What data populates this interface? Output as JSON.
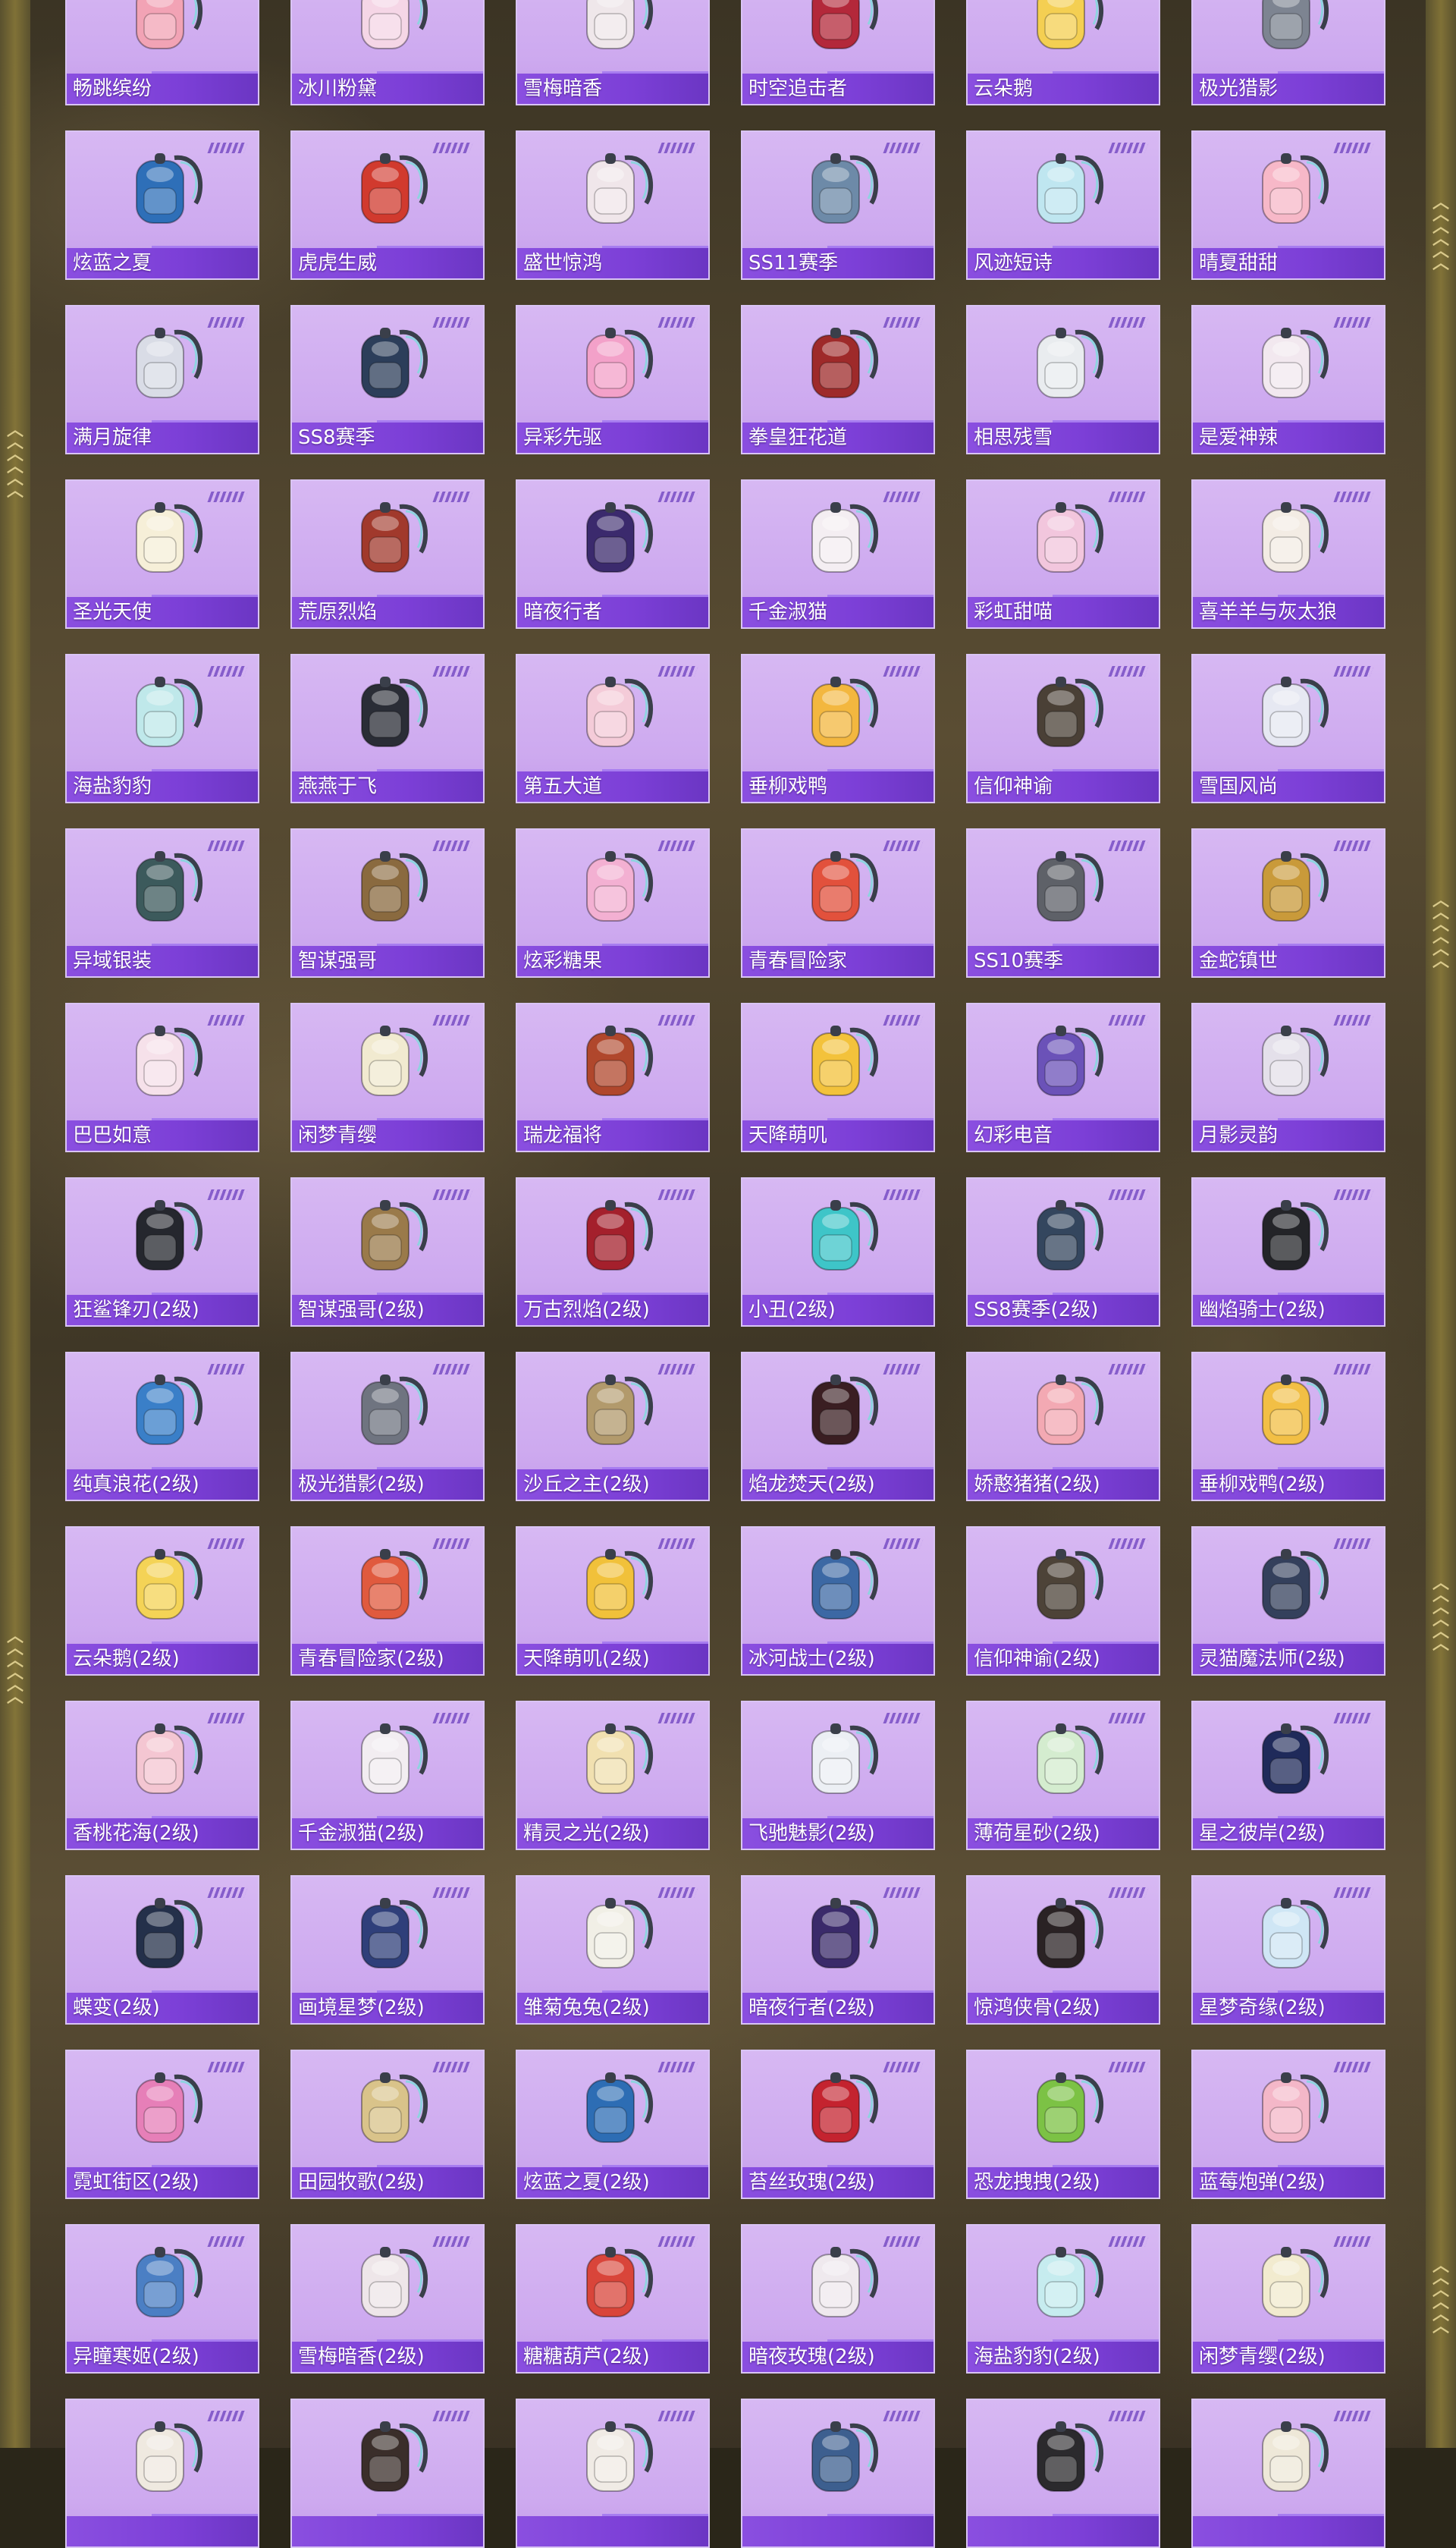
{
  "theme": {
    "card_bg": "#d7b8f3",
    "label_bg": "#7c3fd7",
    "label_text": "#ffffff",
    "accent": "#8c7c3a"
  },
  "items": [
    {
      "name": "畅跳缤纷",
      "icon": "pastel-pink-backpack",
      "color": "#f2a3b5"
    },
    {
      "name": "冰川粉黛",
      "icon": "winged-pink-backpack",
      "color": "#f5d6e6"
    },
    {
      "name": "雪梅暗香",
      "icon": "white-plum-backpack",
      "color": "#efe7ea"
    },
    {
      "name": "时空追击者",
      "icon": "red-mech-backpack",
      "color": "#b3283a"
    },
    {
      "name": "云朵鹅",
      "icon": "yellow-duck-backpack",
      "color": "#f4cf52"
    },
    {
      "name": "极光猎影",
      "icon": "silver-armor-backpack",
      "color": "#7d8491"
    },
    {
      "name": "炫蓝之夏",
      "icon": "blue-tech-backpack",
      "color": "#2e6fb8"
    },
    {
      "name": "虎虎生威",
      "icon": "red-tiger-backpack",
      "color": "#d13a2e"
    },
    {
      "name": "盛世惊鸿",
      "icon": "white-feather-backpack",
      "color": "#f0e6ea"
    },
    {
      "name": "SS11赛季",
      "icon": "blue-grey-backpack",
      "color": "#6d8aa8"
    },
    {
      "name": "风迹短诗",
      "icon": "aqua-crystal-backpack",
      "color": "#bfe6f0"
    },
    {
      "name": "晴夏甜甜",
      "icon": "pink-bunny-backpack",
      "color": "#f7b8c8"
    },
    {
      "name": "满月旋律",
      "icon": "silver-moon-backpack",
      "color": "#d9dce6"
    },
    {
      "name": "SS8赛季",
      "icon": "dark-blue-backpack",
      "color": "#2c3e5a"
    },
    {
      "name": "异彩先驱",
      "icon": "pink-xo-backpack",
      "color": "#f3a1c9"
    },
    {
      "name": "拳皇狂花道",
      "icon": "red-fighter-backpack",
      "color": "#9e2a2a"
    },
    {
      "name": "相思残雪",
      "icon": "white-snow-backpack",
      "color": "#e9ecef"
    },
    {
      "name": "是爱神辣",
      "icon": "white-bunny-backpack",
      "color": "#f2e8ef"
    },
    {
      "name": "圣光天使",
      "icon": "angel-wing-backpack",
      "color": "#f6efd8"
    },
    {
      "name": "荒原烈焰",
      "icon": "red-flame-backpack",
      "color": "#a1392c"
    },
    {
      "name": "暗夜行者",
      "icon": "neon-cat-backpack",
      "color": "#3b2a6d"
    },
    {
      "name": "千金淑猫",
      "icon": "white-cat-backpack",
      "color": "#f4eef2"
    },
    {
      "name": "彩虹甜喵",
      "icon": "pink-cat-backpack",
      "color": "#f2c6dd"
    },
    {
      "name": "喜羊羊与灰太狼",
      "icon": "sheep-backpack",
      "color": "#f3ece4"
    },
    {
      "name": "海盐豹豹",
      "icon": "teal-seal-backpack",
      "color": "#bfe8ea"
    },
    {
      "name": "燕燕于飞",
      "icon": "black-swallow-backpack",
      "color": "#2a2d36"
    },
    {
      "name": "第五大道",
      "icon": "pink-quilted-backpack",
      "color": "#f4cbd8"
    },
    {
      "name": "垂柳戏鸭",
      "icon": "yellow-duck-plush-backpack",
      "color": "#f3b73f"
    },
    {
      "name": "信仰神谕",
      "icon": "dark-gold-crest-backpack",
      "color": "#4a4036"
    },
    {
      "name": "雪国风尚",
      "icon": "penguin-backpack",
      "color": "#e6e8f2"
    },
    {
      "name": "异域银装",
      "icon": "teal-armor-backpack",
      "color": "#3c5a5c"
    },
    {
      "name": "智谋强哥",
      "icon": "brown-bear-backpack",
      "color": "#8a6a3f"
    },
    {
      "name": "炫彩糖果",
      "icon": "donut-backpack",
      "color": "#f3b0d2"
    },
    {
      "name": "青春冒险家",
      "icon": "red-fox-backpack",
      "color": "#e2513c"
    },
    {
      "name": "SS10赛季",
      "icon": "grey-tactical-backpack",
      "color": "#5e6168"
    },
    {
      "name": "金蛇镇世",
      "icon": "gold-snake-backpack",
      "color": "#c99a3a"
    },
    {
      "name": "巴巴如意",
      "icon": "pink-ribbon-backpack",
      "color": "#f6e1ea"
    },
    {
      "name": "闲梦青缨",
      "icon": "cream-lace-backpack",
      "color": "#f1ead0"
    },
    {
      "name": "瑞龙福将",
      "icon": "dragon-warrior-backpack",
      "color": "#b0472c"
    },
    {
      "name": "天降萌叽",
      "icon": "yellow-chick-backpack",
      "color": "#f3c23b"
    },
    {
      "name": "幻彩电音",
      "icon": "speaker-disc-backpack",
      "color": "#6b52b8"
    },
    {
      "name": "月影灵韵",
      "icon": "moon-crescent-backpack",
      "color": "#e4e0ea"
    },
    {
      "name": "狂鲨锋刃(2级)",
      "icon": "black-shark-backpack",
      "color": "#25272e"
    },
    {
      "name": "智谋强哥(2级)",
      "icon": "brown-bear-backpack",
      "color": "#9a7a4a"
    },
    {
      "name": "万古烈焰(2级)",
      "icon": "red-armor-backpack",
      "color": "#a4202c"
    },
    {
      "name": "小丑(2级)",
      "icon": "clown-mask-backpack",
      "color": "#3ec5c8"
    },
    {
      "name": "SS8赛季(2级)",
      "icon": "navy-tactical-backpack",
      "color": "#34465e"
    },
    {
      "name": "幽焰骑士(2级)",
      "icon": "black-knight-backpack",
      "color": "#232428"
    },
    {
      "name": "纯真浪花(2级)",
      "icon": "blue-cup-backpack",
      "color": "#3a7fc8"
    },
    {
      "name": "极光猎影(2级)",
      "icon": "silver-armor-backpack",
      "color": "#6f7480"
    },
    {
      "name": "沙丘之主(2级)",
      "icon": "sand-strap-backpack",
      "color": "#b29a6c"
    },
    {
      "name": "焰龙焚天(2级)",
      "icon": "fire-dragon-backpack",
      "color": "#3a1e22"
    },
    {
      "name": "娇憨猪猪(2级)",
      "icon": "pink-pig-backpack",
      "color": "#f3a9b3"
    },
    {
      "name": "垂柳戏鸭(2级)",
      "icon": "yellow-duck-plush-backpack",
      "color": "#f2bf45"
    },
    {
      "name": "云朵鹅(2级)",
      "icon": "yellow-duck-backpack",
      "color": "#f4d356"
    },
    {
      "name": "青春冒险家(2级)",
      "icon": "red-fox-backpack",
      "color": "#e05a3e"
    },
    {
      "name": "天降萌叽(2级)",
      "icon": "yellow-chick-backpack",
      "color": "#f1c13a"
    },
    {
      "name": "冰河战士(2级)",
      "icon": "ice-warrior-backpack",
      "color": "#3c68a4"
    },
    {
      "name": "信仰神谕(2级)",
      "icon": "dark-gold-crest-backpack",
      "color": "#4d4338"
    },
    {
      "name": "灵猫魔法师(2级)",
      "icon": "cat-mage-backpack",
      "color": "#34405c"
    },
    {
      "name": "香桃花海(2级)",
      "icon": "peach-flower-backpack",
      "color": "#f4c6d2"
    },
    {
      "name": "千金淑猫(2级)",
      "icon": "white-cat-backpack",
      "color": "#f2edf1"
    },
    {
      "name": "精灵之光(2级)",
      "icon": "golden-fairy-backpack",
      "color": "#f1e0b0"
    },
    {
      "name": "飞驰魅影(2级)",
      "icon": "white-racer-backpack",
      "color": "#eceff4"
    },
    {
      "name": "薄荷星砂(2级)",
      "icon": "mint-star-backpack",
      "color": "#d4eccf"
    },
    {
      "name": "星之彼岸(2级)",
      "icon": "space-helmet-backpack",
      "color": "#1f2a5a"
    },
    {
      "name": "蝶变(2级)",
      "icon": "butterfly-backpack",
      "color": "#24304a"
    },
    {
      "name": "画境星梦(2级)",
      "icon": "blue-book-backpack",
      "color": "#2f3f7a"
    },
    {
      "name": "雏菊兔兔(2级)",
      "icon": "daisy-bunny-backpack",
      "color": "#f1efe6"
    },
    {
      "name": "暗夜行者(2级)",
      "icon": "neon-cat-backpack",
      "color": "#3a2a6a"
    },
    {
      "name": "惊鸿侠骨(2级)",
      "icon": "black-red-backpack",
      "color": "#2a2224"
    },
    {
      "name": "星梦奇缘(2级)",
      "icon": "swan-backpack",
      "color": "#cfe6f5"
    },
    {
      "name": "霓虹街区(2级)",
      "icon": "pink-neon-backpack",
      "color": "#e67fb8"
    },
    {
      "name": "田园牧歌(2级)",
      "icon": "wicker-basket-backpack",
      "color": "#d9c38a"
    },
    {
      "name": "炫蓝之夏(2级)",
      "icon": "blue-tech-backpack",
      "color": "#2d6db4"
    },
    {
      "name": "苔丝玫瑰(2级)",
      "icon": "red-rose-backpack",
      "color": "#c4232f"
    },
    {
      "name": "恐龙拽拽(2级)",
      "icon": "green-dino-backpack",
      "color": "#7cc245"
    },
    {
      "name": "蓝莓炮弹(2级)",
      "icon": "blueberry-cake-backpack",
      "color": "#f4b7c8"
    },
    {
      "name": "异瞳寒姬(2级)",
      "icon": "blue-doll-backpack",
      "color": "#4b7fc4"
    },
    {
      "name": "雪梅暗香(2级)",
      "icon": "white-plum-backpack",
      "color": "#eee6e9"
    },
    {
      "name": "糖糖葫芦(2级)",
      "icon": "candied-gourd-backpack",
      "color": "#d9453a"
    },
    {
      "name": "暗夜玫瑰(2级)",
      "icon": "white-rose-bunny-backpack",
      "color": "#efe9ee"
    },
    {
      "name": "海盐豹豹(2级)",
      "icon": "teal-seal-backpack",
      "color": "#c6ecef"
    },
    {
      "name": "闲梦青缨(2级)",
      "icon": "cream-lace-backpack",
      "color": "#f2ebcf"
    },
    {
      "name": "",
      "icon": "white-strap-backpack",
      "color": "#efe9e0"
    },
    {
      "name": "",
      "icon": "dark-brown-backpack",
      "color": "#3a2e2a"
    },
    {
      "name": "",
      "icon": "white-strap-backpack",
      "color": "#f0ebe5"
    },
    {
      "name": "",
      "icon": "blue-armor-backpack",
      "color": "#3d5f8f"
    },
    {
      "name": "",
      "icon": "black-gold-backpack",
      "color": "#2b2a2d"
    },
    {
      "name": "",
      "icon": "cream-strap-backpack",
      "color": "#eee8d8"
    }
  ]
}
